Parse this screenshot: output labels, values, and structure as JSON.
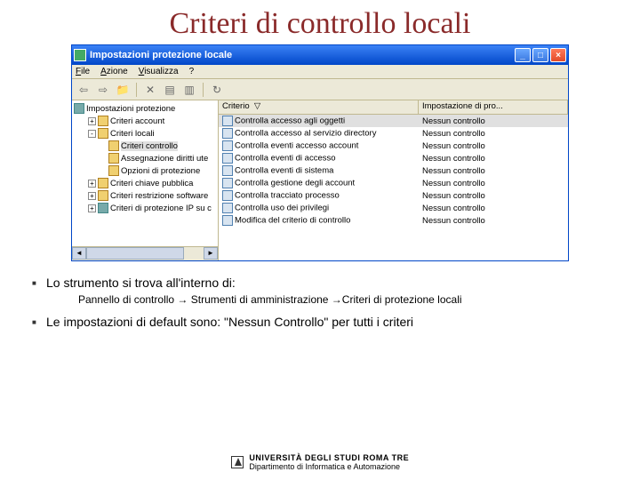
{
  "slide": {
    "title": "Criteri di controllo locali"
  },
  "window": {
    "title": "Impostazioni protezione locale",
    "window_controls": {
      "minimize": "_",
      "maximize": "□",
      "close": "×"
    },
    "menu": {
      "file": "File",
      "azione": "Azione",
      "visualizza": "Visualizza",
      "help": "?"
    },
    "toolbar_icons": [
      "back",
      "forward",
      "up",
      "sep",
      "cut",
      "properties",
      "list",
      "sep",
      "refresh"
    ]
  },
  "tree": {
    "root": "Impostazioni protezione",
    "items": [
      {
        "exp": "+",
        "indent": 1,
        "label": "Criteri account",
        "icon": "folder"
      },
      {
        "exp": "-",
        "indent": 1,
        "label": "Criteri locali",
        "icon": "folder"
      },
      {
        "exp": "",
        "indent": 2,
        "label": "Criteri controllo",
        "icon": "folder",
        "selected": true
      },
      {
        "exp": "",
        "indent": 2,
        "label": "Assegnazione diritti ute",
        "icon": "folder"
      },
      {
        "exp": "",
        "indent": 2,
        "label": "Opzioni di protezione",
        "icon": "folder"
      },
      {
        "exp": "+",
        "indent": 1,
        "label": "Criteri chiave pubblica",
        "icon": "folder"
      },
      {
        "exp": "+",
        "indent": 1,
        "label": "Criteri restrizione software",
        "icon": "folder"
      },
      {
        "exp": "+",
        "indent": 1,
        "label": "Criteri di protezione IP su c",
        "icon": "gear"
      }
    ]
  },
  "list": {
    "columns": {
      "name": "Criterio",
      "sort_indicator": "▽",
      "setting": "Impostazione di pro..."
    },
    "rows": [
      {
        "name": "Controlla accesso agli oggetti",
        "setting": "Nessun controllo",
        "selected": true
      },
      {
        "name": "Controlla accesso al servizio directory",
        "setting": "Nessun controllo"
      },
      {
        "name": "Controlla eventi accesso account",
        "setting": "Nessun controllo"
      },
      {
        "name": "Controlla eventi di accesso",
        "setting": "Nessun controllo"
      },
      {
        "name": "Controlla eventi di sistema",
        "setting": "Nessun controllo"
      },
      {
        "name": "Controlla gestione degli account",
        "setting": "Nessun controllo"
      },
      {
        "name": "Controlla tracciato processo",
        "setting": "Nessun controllo"
      },
      {
        "name": "Controlla uso dei privilegi",
        "setting": "Nessun controllo"
      },
      {
        "name": "Modifica del criterio di controllo",
        "setting": "Nessun controllo"
      }
    ]
  },
  "bullets": {
    "b1": "Lo strumento si trova all'interno di:",
    "b1_sub": "Pannello di controllo → Strumenti di amministrazione →Criteri di protezione locali",
    "b2": "Le impostazioni di default sono: \"Nessun Controllo\" per tutti i criteri"
  },
  "footer": {
    "line1": "UNIVERSITÀ DEGLI STUDI ROMA TRE",
    "line2": "Dipartimento di Informatica e Automazione"
  }
}
